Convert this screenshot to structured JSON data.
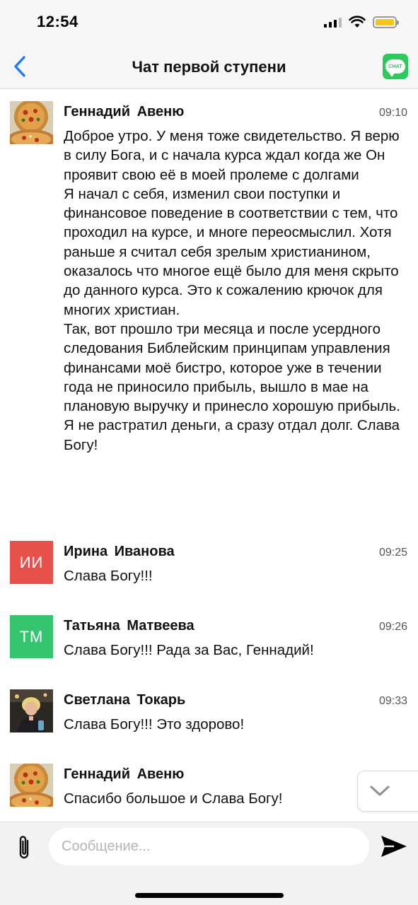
{
  "status_bar": {
    "time": "12:54"
  },
  "nav": {
    "title": "Чат первой ступени",
    "back_icon": "chevron-left-icon",
    "chat_badge_label": "CHAT",
    "chat_badge_color": "#2cc95c"
  },
  "messages": [
    {
      "author": "Геннадий  Авеню",
      "time": "09:10",
      "avatar": "pizza-photo",
      "paragraphs": [
        "Доброе утро. У меня тоже свидетельство. Я верю в силу Бога, и с начала курса ждал когда же Он проявит свою её в моей пролеме с долгами",
        "Я начал с себя, изменил свои поступки и финансовое поведение в соответствии с тем, что проходил на курсе, и многе переосмыслил. Хотя раньше я считал себя зрелым христианином, оказалось что многое ещё было для меня скрыто до данного курса. Это к сожалению крючок для многих христиан.",
        "Так, вот прошло три месяца и после усердного следования Библейским принципам управления финансами моё бистро, которое уже в течении года не приносило прибыль, вышло в мае на плановую выручку и принесло хорошую прибыль. Я не растратил деньги, а сразу отдал долг. Слава Богу!"
      ]
    },
    {
      "author": "Ирина Иванова",
      "time": "09:25",
      "avatar_initials": "ИИ",
      "avatar_color": "#e8504a",
      "paragraphs": [
        "Слава Богу!!!"
      ]
    },
    {
      "author": "Татьяна  Матвеева",
      "time": "09:26",
      "avatar_initials": "ТМ",
      "avatar_color": "#35c56f",
      "paragraphs": [
        "Слава Богу!!! Рада за Вас, Геннадий!"
      ]
    },
    {
      "author": "Светлана  Токарь",
      "time": "09:33",
      "avatar": "woman-photo",
      "paragraphs": [
        "Слава Богу!!! Это здорово!"
      ]
    },
    {
      "author": "Геннадий  Авеню",
      "time": "",
      "avatar": "pizza-photo",
      "paragraphs": [
        "Спасибо большое и Слава Богу!"
      ]
    }
  ],
  "scroll_down_icon": "chevron-down-icon",
  "composer": {
    "placeholder": "Сообщение...",
    "value": "",
    "attach_icon": "paperclip-icon",
    "send_icon": "send-arrow-icon"
  }
}
